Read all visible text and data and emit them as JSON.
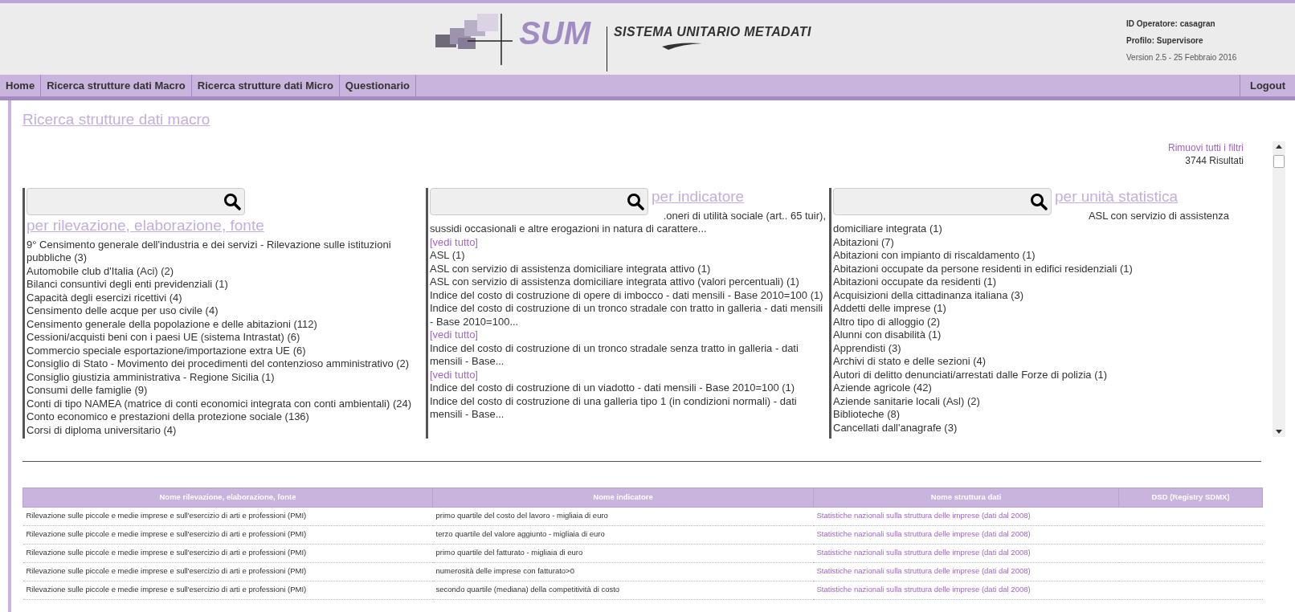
{
  "header": {
    "logo_title": "SUM",
    "logo_subtitle": "SISTEMA UNITARIO METADATI",
    "user_info": [
      "ID Operatore: casagran",
      "Profilo: Supervisore",
      "Version 2.5 - 25 Febbraio 2016"
    ]
  },
  "nav": {
    "items": [
      "Home",
      "Ricerca strutture dati Macro",
      "Ricerca strutture dati Micro",
      "Questionario"
    ],
    "logout": "Logout"
  },
  "page_title": "Ricerca strutture dati macro",
  "remove_filters": "Rimuovi tutti i filtri",
  "results_count": "3744 Risultati",
  "filters": [
    {
      "heading": "per rilevazione, elaborazione, fonte",
      "heading_beside_search": false,
      "items": [
        {
          "kind": "item",
          "text": "9° Censimento generale dell'industria e dei servizi - Rilevazione sulle istituzioni pubbliche (3)"
        },
        {
          "kind": "item",
          "text": "Automobile club d'Italia (Aci) (2)"
        },
        {
          "kind": "item",
          "text": "Bilanci consuntivi degli enti previdenziali (1)"
        },
        {
          "kind": "item",
          "text": "Capacità degli esercizi ricettivi (4)"
        },
        {
          "kind": "item",
          "text": "Censimento delle acque per uso civile (4)"
        },
        {
          "kind": "item",
          "text": "Censimento generale della popolazione e delle abitazioni (112)"
        },
        {
          "kind": "item",
          "text": "Cessioni/acquisti beni con i paesi UE (sistema Intrastat) (6)"
        },
        {
          "kind": "item",
          "text": "Commercio speciale esportazione/importazione extra UE (6)"
        },
        {
          "kind": "item",
          "text": "Consiglio di Stato - Movimento dei procedimenti del contenzioso amministrativo (2)"
        },
        {
          "kind": "item",
          "text": "Consiglio giustizia amministrativa - Regione Sicilia (1)"
        },
        {
          "kind": "item",
          "text": "Consumi delle famiglie (9)"
        },
        {
          "kind": "item",
          "text": "Conti di tipo NAMEA (matrice di conti economici integrata con conti ambientali) (24)"
        },
        {
          "kind": "item",
          "text": "Conto economico e prestazioni della protezione sociale (136)"
        },
        {
          "kind": "item",
          "text": "Corsi di diploma universitario (4)"
        }
      ]
    },
    {
      "heading": "per indicatore",
      "heading_beside_search": true,
      "items": [
        {
          "kind": "item",
          "text": ".oneri di utilità sociale (art.. 65 tuir), sussidi occasionali e altre erogazioni in natura di carattere..."
        },
        {
          "kind": "more",
          "text": "[vedi tutto]"
        },
        {
          "kind": "item",
          "text": "ASL (1)"
        },
        {
          "kind": "item",
          "text": "ASL con servizio di assistenza domiciliare integrata attivo (1)"
        },
        {
          "kind": "item",
          "text": "ASL con servizio di assistenza domiciliare integrata attivo (valori percentuali) (1)"
        },
        {
          "kind": "item",
          "text": "Indice del costo di costruzione di opere di imbocco - dati mensili - Base 2010=100 (1)"
        },
        {
          "kind": "item",
          "text": "Indice del costo di costruzione di un tronco stradale con tratto in galleria - dati mensili - Base 2010=100..."
        },
        {
          "kind": "more",
          "text": "[vedi tutto]"
        },
        {
          "kind": "item",
          "text": "Indice del costo di costruzione di un tronco stradale senza tratto in galleria - dati mensili - Base..."
        },
        {
          "kind": "more",
          "text": "[vedi tutto]"
        },
        {
          "kind": "item",
          "text": "Indice del costo di costruzione di un viadotto - dati mensili - Base 2010=100 (1)"
        },
        {
          "kind": "item",
          "text": "Indice del costo di costruzione di una galleria tipo 1 (in condizioni normali) - dati mensili - Base..."
        }
      ]
    },
    {
      "heading": "per unità statistica",
      "heading_beside_search": true,
      "items": [
        {
          "kind": "item",
          "text": "ASL con servizio di assistenza domiciliare integrata (1)"
        },
        {
          "kind": "item",
          "text": "Abitazioni (7)"
        },
        {
          "kind": "item",
          "text": "Abitazioni con impianto di riscaldamento (1)"
        },
        {
          "kind": "item",
          "text": "Abitazioni occupate da persone residenti in edifici residenziali (1)"
        },
        {
          "kind": "item",
          "text": "Abitazioni occupate da residenti (1)"
        },
        {
          "kind": "item",
          "text": "Acquisizioni della cittadinanza italiana (3)"
        },
        {
          "kind": "item",
          "text": "Addetti delle imprese (1)"
        },
        {
          "kind": "item",
          "text": "Altro tipo di alloggio (2)"
        },
        {
          "kind": "item",
          "text": "Alunni con disabilità (1)"
        },
        {
          "kind": "item",
          "text": "Apprendisti (3)"
        },
        {
          "kind": "item",
          "text": "Archivi di stato e delle sezioni (4)"
        },
        {
          "kind": "item",
          "text": "Autori di delitto denunciati/arrestati dalle Forze di polizia (1)"
        },
        {
          "kind": "item",
          "text": "Aziende agricole (42)"
        },
        {
          "kind": "item",
          "text": "Aziende sanitarie locali (Asl) (2)"
        },
        {
          "kind": "item",
          "text": "Biblioteche (8)"
        },
        {
          "kind": "item",
          "text": "Cancellati dall'anagrafe (3)"
        }
      ]
    }
  ],
  "table": {
    "columns": [
      "Nome rilevazione, elaborazione, fonte",
      "Nome indicatore",
      "Nome struttura dati",
      "DSD (Registry SDMX)"
    ],
    "rows": [
      [
        "Rilevazione sulle piccole e medie imprese e sull'esercizio di arti e professioni (PMI)",
        "primo quartile del costo del lavoro - migliaia di euro",
        "Statistiche nazionali sulla struttura delle imprese (dati dal 2008)"
      ],
      [
        "Rilevazione sulle piccole e medie imprese e sull'esercizio di arti e professioni (PMI)",
        "terzo quartile del valore aggiunto - migliaia di euro",
        "Statistiche nazionali sulla struttura delle imprese (dati dal 2008)"
      ],
      [
        "Rilevazione sulle piccole e medie imprese e sull'esercizio di arti e professioni (PMI)",
        "primo quartile del fatturato - migliaia di euro",
        "Statistiche nazionali sulla struttura delle imprese (dati dal 2008)"
      ],
      [
        "Rilevazione sulle piccole e medie imprese e sull'esercizio di arti e professioni (PMI)",
        "numerosità delle imprese con fatturato>0",
        "Statistiche nazionali sulla struttura delle imprese (dati dal 2008)"
      ],
      [
        "Rilevazione sulle piccole e medie imprese e sull'esercizio di arti e professioni (PMI)",
        "secondo quartile (mediana) della competitività di costo",
        "Statistiche nazionali sulla struttura delle imprese (dati dal 2008)"
      ]
    ]
  }
}
